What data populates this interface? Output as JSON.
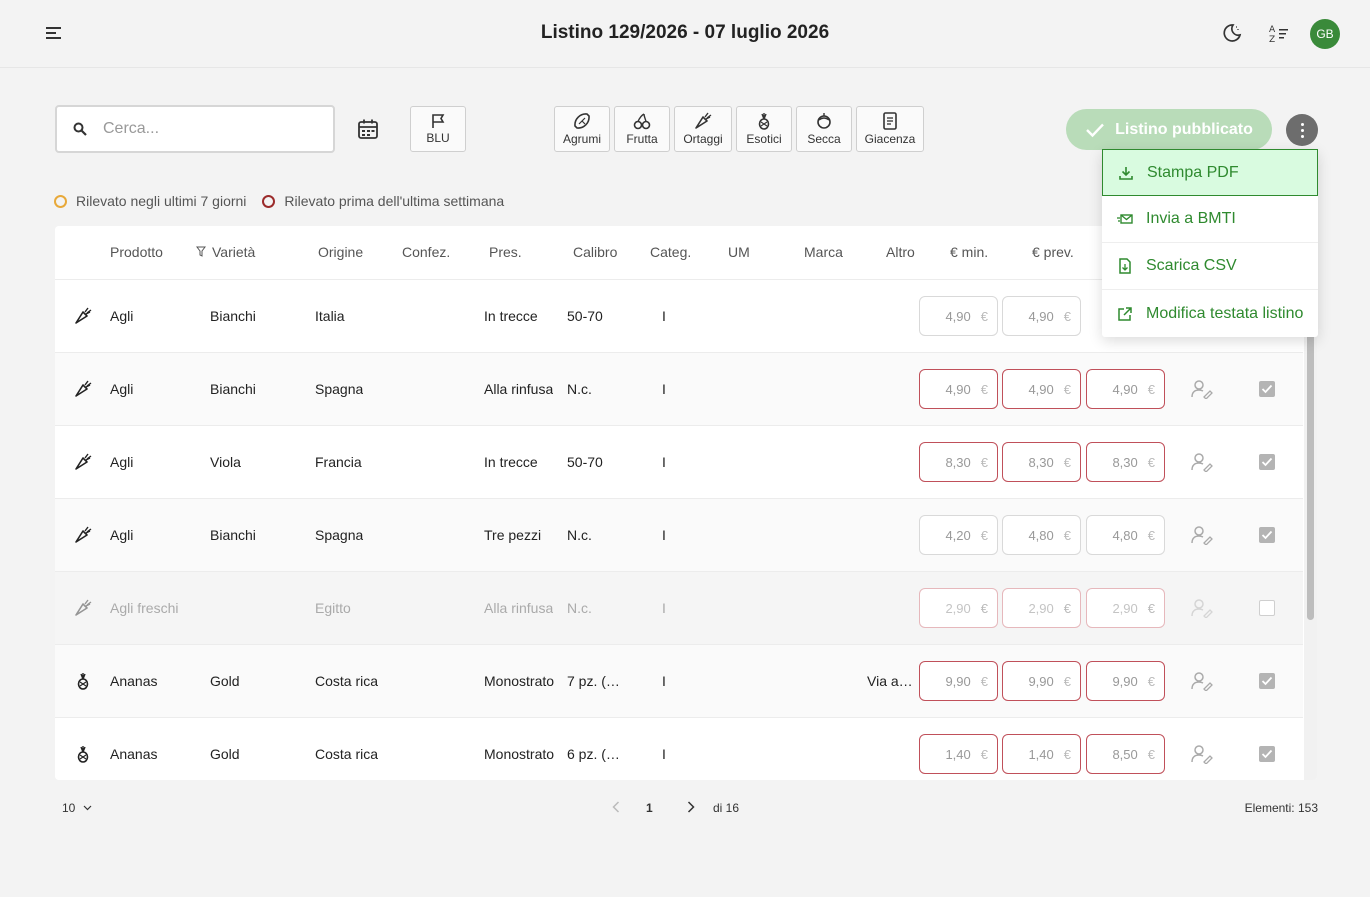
{
  "header": {
    "title": "Listino 129/2026 - 07 luglio 2026",
    "user_initials": "GB",
    "icons": [
      "menu-icon",
      "night-mode-icon",
      "sort-filter-icon"
    ]
  },
  "toolbar": {
    "search_placeholder": "Cerca...",
    "flag_label": "BLU",
    "categories": [
      {
        "label": "Agrumi",
        "icon": "citrus-icon"
      },
      {
        "label": "Frutta",
        "icon": "cherry-icon"
      },
      {
        "label": "Ortaggi",
        "icon": "carrot-icon"
      },
      {
        "label": "Esotici",
        "icon": "pineapple-icon"
      },
      {
        "label": "Secca",
        "icon": "dried-fruit-icon"
      },
      {
        "label": "Giacenza",
        "icon": "stock-icon"
      }
    ],
    "publish_label": "Listino pubblicato"
  },
  "menu": {
    "items": [
      {
        "label": "Stampa PDF",
        "icon": "download-icon"
      },
      {
        "label": "Invia a BMTI",
        "icon": "send-mail-icon"
      },
      {
        "label": "Scarica CSV",
        "icon": "csv-file-icon"
      },
      {
        "label": "Modifica testata listino",
        "icon": "external-edit-icon"
      }
    ]
  },
  "legend": {
    "recent_label": "Rilevato negli ultimi 7 giorni",
    "recent_color": "#e8a93a",
    "old_label": "Rilevato prima dell'ultima settimana",
    "old_color": "#9b2b2b"
  },
  "table": {
    "columns": [
      "Prodotto",
      "Varietà",
      "Origine",
      "Confez.",
      "Pres.",
      "Calibro",
      "Categ.",
      "UM",
      "Marca",
      "Altro",
      "€ min.",
      "€ prev."
    ],
    "currency": "€",
    "rows": [
      {
        "icon": "carrot-icon",
        "product": "Agli",
        "variety": "Bianchi",
        "origin": "Italia",
        "confez": "",
        "pres": "In trecce",
        "calibro": "50-70",
        "categ": "I",
        "um": "",
        "marca": "",
        "altro": "",
        "prices": [
          "4,90",
          "4,90",
          ""
        ],
        "checked": true
      },
      {
        "icon": "carrot-icon",
        "product": "Agli",
        "variety": "Bianchi",
        "origin": "Spagna",
        "confez": "",
        "pres": "Alla rinfusa",
        "calibro": "N.c.",
        "categ": "I",
        "um": "",
        "marca": "",
        "altro": "",
        "prices": [
          "4,90",
          "4,90",
          "4,90"
        ],
        "checked": true
      },
      {
        "icon": "carrot-icon",
        "product": "Agli",
        "variety": "Viola",
        "origin": "Francia",
        "confez": "",
        "pres": "In trecce",
        "calibro": "50-70",
        "categ": "I",
        "um": "",
        "marca": "",
        "altro": "",
        "prices": [
          "8,30",
          "8,30",
          "8,30"
        ],
        "checked": true
      },
      {
        "icon": "carrot-icon",
        "product": "Agli",
        "variety": "Bianchi",
        "origin": "Spagna",
        "confez": "",
        "pres": "Tre pezzi",
        "calibro": "N.c.",
        "categ": "I",
        "um": "",
        "marca": "",
        "altro": "",
        "prices": [
          "4,20",
          "4,80",
          "4,80"
        ],
        "checked": true
      },
      {
        "icon": "carrot-icon",
        "product": "Agli freschi",
        "variety": "",
        "origin": "Egitto",
        "confez": "",
        "pres": "Alla rinfusa",
        "calibro": "N.c.",
        "categ": "I",
        "um": "",
        "marca": "",
        "altro": "",
        "prices": [
          "2,90",
          "2,90",
          "2,90"
        ],
        "checked": false
      },
      {
        "icon": "pineapple-icon",
        "product": "Ananas",
        "variety": "Gold",
        "origin": "Costa rica",
        "confez": "",
        "pres": "Monostrato",
        "calibro": "7 pz. (…",
        "categ": "I",
        "um": "",
        "marca": "",
        "altro": "Via a…",
        "prices": [
          "9,90",
          "9,90",
          "9,90"
        ],
        "checked": true
      },
      {
        "icon": "pineapple-icon",
        "product": "Ananas",
        "variety": "Gold",
        "origin": "Costa rica",
        "confez": "",
        "pres": "Monostrato",
        "calibro": "6 pz. (…",
        "categ": "I",
        "um": "",
        "marca": "",
        "altro": "",
        "prices": [
          "1,40",
          "1,40",
          "8,50"
        ],
        "checked": true
      }
    ]
  },
  "pagination": {
    "page_size": "10",
    "current_page": "1",
    "total_pages_label": "di 16",
    "count_label": "Elementi: 153"
  }
}
